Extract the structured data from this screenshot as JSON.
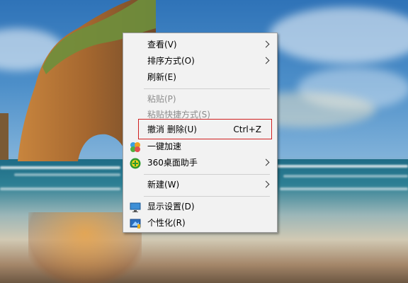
{
  "context_menu": {
    "items": [
      {
        "label": "查看(V)",
        "submenu": true
      },
      {
        "label": "排序方式(O)",
        "submenu": true
      },
      {
        "label": "刷新(E)"
      },
      {
        "label": "粘贴(P)",
        "disabled": true
      },
      {
        "label": "粘贴快捷方式(S)",
        "disabled": true
      },
      {
        "label": "撤消 删除(U)",
        "shortcut": "Ctrl+Z",
        "highlighted": true
      },
      {
        "label": "一键加速",
        "icon": "speedup-icon"
      },
      {
        "label": "360桌面助手",
        "icon": "360-assistant-icon",
        "submenu": true
      },
      {
        "label": "新建(W)",
        "submenu": true
      },
      {
        "label": "显示设置(D)",
        "icon": "display-settings-icon"
      },
      {
        "label": "个性化(R)",
        "icon": "personalize-icon"
      }
    ],
    "highlight_color": "#d02020"
  }
}
